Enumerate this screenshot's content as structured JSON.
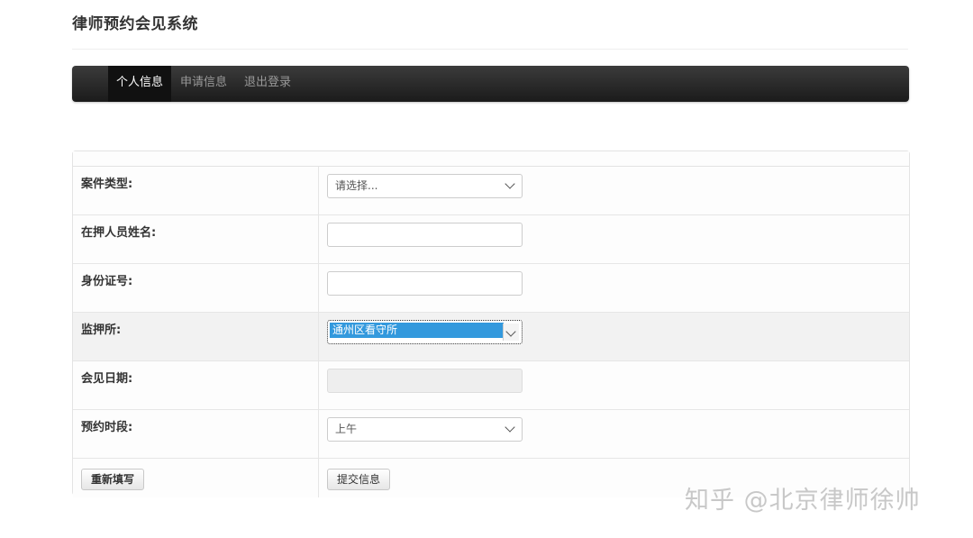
{
  "app": {
    "title": "律师预约会见系统"
  },
  "nav": {
    "items": [
      {
        "label": "个人信息",
        "active": true
      },
      {
        "label": "申请信息",
        "active": false
      },
      {
        "label": "退出登录",
        "active": false
      }
    ]
  },
  "form": {
    "case_type": {
      "label": "案件类型:",
      "placeholder": "请选择..."
    },
    "detainee_name": {
      "label": "在押人员姓名:",
      "value": ""
    },
    "id_number": {
      "label": "身份证号:",
      "value": ""
    },
    "detention_center": {
      "label": "监押所:",
      "value": "通州区看守所"
    },
    "visit_date": {
      "label": "会见日期:",
      "value": ""
    },
    "time_slot": {
      "label": "预约时段:",
      "value": "上午"
    },
    "reset_label": "重新填写",
    "submit_label": "提交信息"
  },
  "watermark": {
    "text": "知乎 @北京律师徐帅"
  },
  "colors": {
    "navbar": "#222222",
    "selection": "#3399dd",
    "nav_active_text": "#ffffff"
  }
}
